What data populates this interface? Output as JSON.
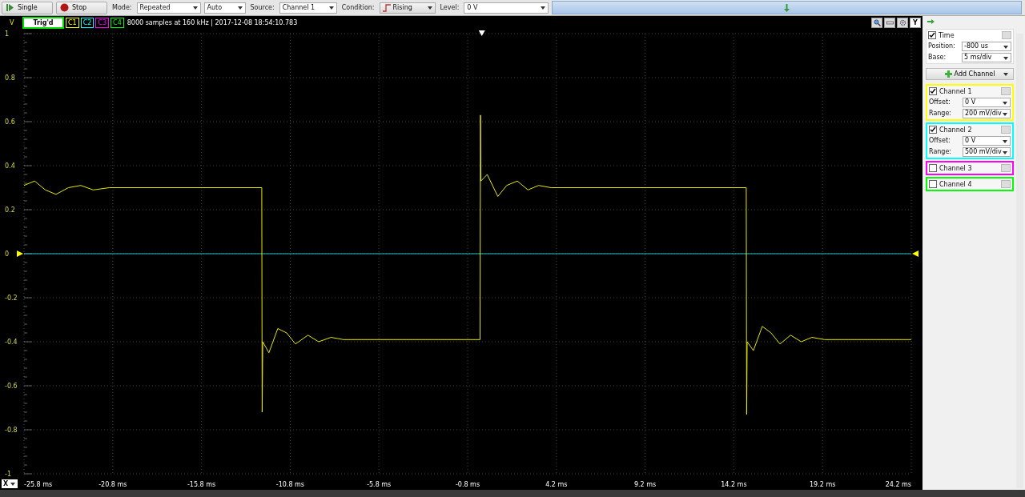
{
  "toolbar": {
    "single_button": "Single",
    "stop_button": "Stop",
    "mode_label": "Mode:",
    "mode": "Repeated",
    "mode_option": "Auto",
    "source_label": "Source:",
    "source": "Channel 1",
    "condition_label": "Condition:",
    "condition": "Rising",
    "level_label": "Level:",
    "level": "0 V"
  },
  "plot": {
    "y_unit": "V",
    "trigger_status": "Trig'd",
    "channel_tags": [
      {
        "label": "C1",
        "color": "#ffff00"
      },
      {
        "label": "C2",
        "color": "#00ffff"
      },
      {
        "label": "C3",
        "color": "#ff00ff"
      },
      {
        "label": "C4",
        "color": "#00ff00"
      }
    ],
    "info": "8000 samples at 160 kHz | 2017-12-08 18:54:10.783",
    "y_axis_button": "Y",
    "x_axis_button": "X",
    "chart_data": {
      "type": "line",
      "grid": true,
      "xlim": [
        -25.8,
        24.2
      ],
      "ylim": [
        -1,
        1
      ],
      "yticks": [
        1,
        0.8,
        0.6,
        0.4,
        0.2,
        0,
        -0.2,
        -0.4,
        -0.6,
        -0.8,
        -1
      ],
      "xticks": [
        {
          "value": -25.8,
          "label": "-25.8 ms"
        },
        {
          "value": -20.8,
          "label": "-20.8 ms"
        },
        {
          "value": -15.8,
          "label": "-15.8 ms"
        },
        {
          "value": -10.8,
          "label": "-10.8 ms"
        },
        {
          "value": -5.8,
          "label": "-5.8 ms"
        },
        {
          "value": -0.8,
          "label": "-0.8 ms"
        },
        {
          "value": 4.2,
          "label": "4.2 ms"
        },
        {
          "value": 9.2,
          "label": "9.2 ms"
        },
        {
          "value": 14.2,
          "label": "14.2 ms"
        },
        {
          "value": 19.2,
          "label": "19.2 ms"
        },
        {
          "value": 24.2,
          "label": "24.2 ms"
        }
      ],
      "series": [
        {
          "color": "#e8e800",
          "x": [
            -25.8,
            -25.2,
            -24.6,
            -24.0,
            -23.3,
            -22.6,
            -21.9,
            -21.0,
            -12.4,
            -12.38,
            -12.35,
            -12.0,
            -11.5,
            -11.0,
            -10.5,
            -9.8,
            -9.2,
            -8.5,
            -7.8,
            -0.1,
            -0.08,
            -0.05,
            0.3,
            0.9,
            1.4,
            2.0,
            2.6,
            3.2,
            3.9,
            14.9,
            14.92,
            14.95,
            15.3,
            15.8,
            16.3,
            16.8,
            17.4,
            18.0,
            18.6,
            19.3,
            24.2
          ],
          "values": [
            0.31,
            0.33,
            0.29,
            0.27,
            0.3,
            0.31,
            0.29,
            0.3,
            0.3,
            -0.72,
            -0.4,
            -0.45,
            -0.34,
            -0.36,
            -0.41,
            -0.37,
            -0.4,
            -0.38,
            -0.39,
            -0.39,
            0.63,
            0.33,
            0.36,
            0.26,
            0.31,
            0.33,
            0.29,
            0.31,
            0.3,
            0.3,
            -0.73,
            -0.4,
            -0.44,
            -0.33,
            -0.36,
            -0.41,
            -0.37,
            -0.4,
            -0.38,
            -0.39,
            -0.39
          ]
        },
        {
          "color": "#20c0c8",
          "x": [
            -25.8,
            24.2
          ],
          "values": [
            0,
            0
          ]
        }
      ]
    }
  },
  "panel": {
    "time": {
      "label": "Time",
      "checked": true,
      "position_label": "Position:",
      "position": "-800 us",
      "base_label": "Base:",
      "base": "5 ms/div"
    },
    "add_channel": "Add Channel",
    "channels": [
      {
        "name": "Channel 1",
        "checked": true,
        "color": "#ffff00",
        "offset_label": "Offset:",
        "offset": "0 V",
        "range_label": "Range:",
        "range": "200 mV/div"
      },
      {
        "name": "Channel 2",
        "checked": true,
        "color": "#00ffff",
        "offset_label": "Offset:",
        "offset": "0 V",
        "range_label": "Range:",
        "range": "500 mV/div"
      },
      {
        "name": "Channel 3",
        "checked": false,
        "color": "#ff00ff"
      },
      {
        "name": "Channel 4",
        "checked": false,
        "color": "#00ff00"
      }
    ]
  }
}
